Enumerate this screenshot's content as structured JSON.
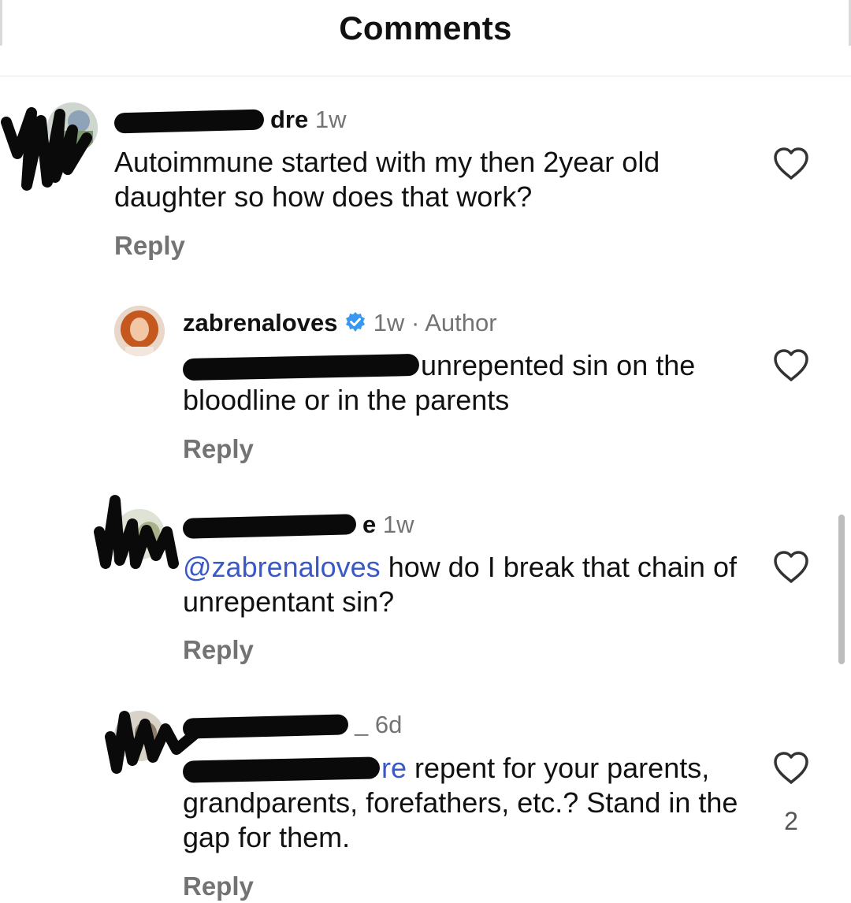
{
  "header": {
    "title": "Comments"
  },
  "comments": [
    {
      "username_visible_tail": "dre",
      "time": "1w",
      "text": "Autoimmune started with my then 2year old daughter so how does that work?",
      "reply_label": "Reply"
    },
    {
      "username": "zabrenaloves",
      "verified": true,
      "time": "1w",
      "separator": "·",
      "author_label": "Author",
      "text": "unrepented sin on the bloodline or in the parents",
      "reply_label": "Reply"
    },
    {
      "username_visible_tail": "e",
      "time": "1w",
      "mention": "@zabrenaloves",
      "text": " how do I break that chain of unrepentant sin?",
      "reply_label": "Reply"
    },
    {
      "username_visible_tail": "_",
      "time": "6d",
      "mention_visible_tail": "re",
      "text": " repent for your parents, grandparents, forefathers, etc.? Stand in the gap for them.",
      "reply_label": "Reply",
      "like_count": "2"
    }
  ],
  "colors": {
    "mention": "#3a59c7",
    "secondary_text": "#737373",
    "verified_badge": "#3897f0"
  },
  "icons": {
    "like": "heart-outline-icon",
    "verified": "verified-badge-icon"
  }
}
